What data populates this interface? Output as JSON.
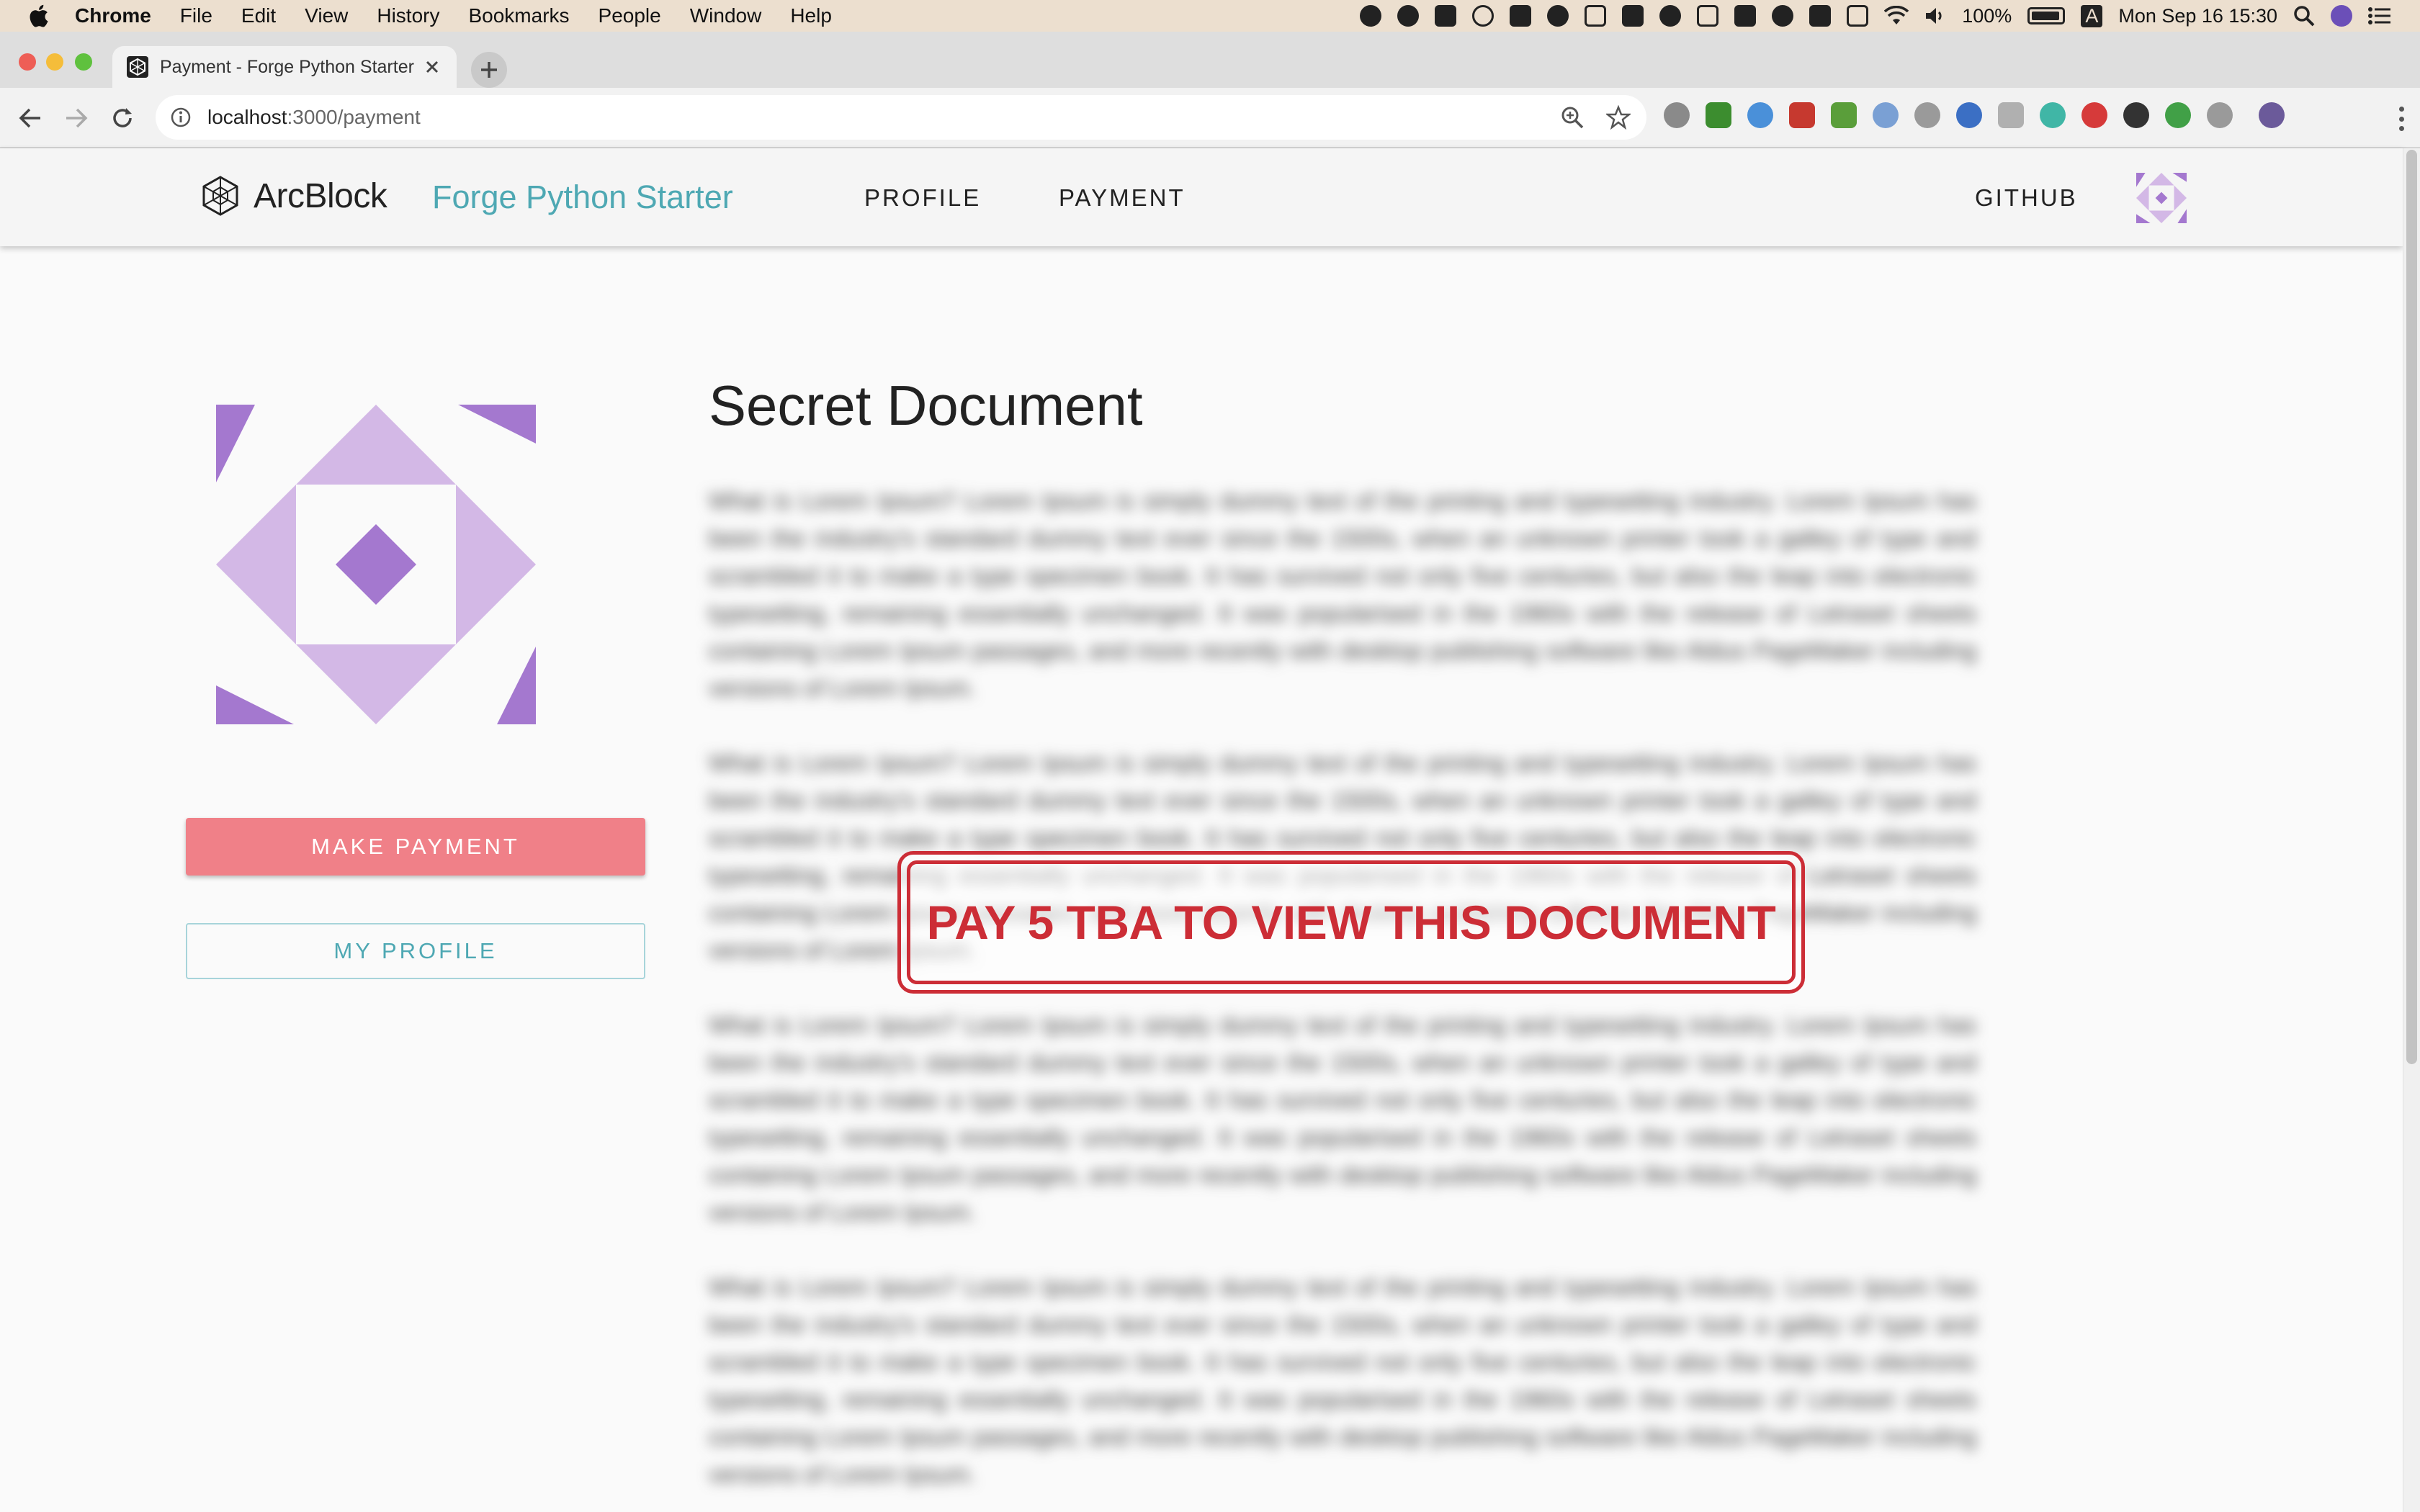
{
  "menubar": {
    "app": "Chrome",
    "items": [
      "File",
      "Edit",
      "View",
      "History",
      "Bookmarks",
      "People",
      "Window",
      "Help"
    ],
    "battery": "100%",
    "input_source": "A",
    "clock": "Mon Sep 16  15:30"
  },
  "browser": {
    "tab_title": "Payment - Forge Python Starter",
    "url_host": "localhost",
    "url_path": ":3000/payment"
  },
  "header": {
    "brand": "ArcBlock",
    "app_title": "Forge Python Starter",
    "nav": {
      "profile": "PROFILE",
      "payment": "PAYMENT",
      "github": "GITHUB"
    }
  },
  "sidebar": {
    "make_payment": "MAKE PAYMENT",
    "my_profile": "MY PROFILE"
  },
  "document": {
    "title": "Secret Document",
    "paragraphs": [
      "What is Lorem Ipsum? Lorem Ipsum is simply dummy text of the printing and typesetting industry. Lorem Ipsum has been the industry's standard dummy text ever since the 1500s, when an unknown printer took a galley of type and scrambled it to make a type specimen book. It has survived not only five centuries, but also the leap into electronic typesetting, remaining essentially unchanged. It was popularised in the 1960s with the release of Letraset sheets containing Lorem Ipsum passages, and more recently with desktop publishing software like Aldus PageMaker including versions of Lorem Ipsum.",
      "What is Lorem Ipsum? Lorem Ipsum is simply dummy text of the printing and typesetting industry. Lorem Ipsum has been the industry's standard dummy text ever since the 1500s, when an unknown printer took a galley of type and scrambled it to make a type specimen book. It has survived not only five centuries, but also the leap into electronic typesetting, remaining essentially unchanged. It was popularised in the 1960s with the release of Letraset sheets containing Lorem Ipsum passages, and more recently with desktop publishing software like Aldus PageMaker including versions of Lorem Ipsum.",
      "What is Lorem Ipsum? Lorem Ipsum is simply dummy text of the printing and typesetting industry. Lorem Ipsum has been the industry's standard dummy text ever since the 1500s, when an unknown printer took a galley of type and scrambled it to make a type specimen book. It has survived not only five centuries, but also the leap into electronic typesetting, remaining essentially unchanged. It was popularised in the 1960s with the release of Letraset sheets containing Lorem Ipsum passages, and more recently with desktop publishing software like Aldus PageMaker including versions of Lorem Ipsum.",
      "What is Lorem Ipsum? Lorem Ipsum is simply dummy text of the printing and typesetting industry. Lorem Ipsum has been the industry's standard dummy text ever since the 1500s, when an unknown printer took a galley of type and scrambled it to make a type specimen book. It has survived not only five centuries, but also the leap into electronic typesetting, remaining essentially unchanged. It was popularised in the 1960s with the release of Letraset sheets containing Lorem Ipsum passages, and more recently with desktop publishing software like Aldus PageMaker including versions of Lorem Ipsum."
    ],
    "stamp": "PAY 5 TBA TO VIEW THIS DOCUMENT"
  },
  "colors": {
    "accent_teal": "#4ea8b3",
    "button_pink": "#f08088",
    "stamp_red": "#cc2d36",
    "avatar_light": "#d3b8e6",
    "avatar_dark": "#a478cf"
  }
}
